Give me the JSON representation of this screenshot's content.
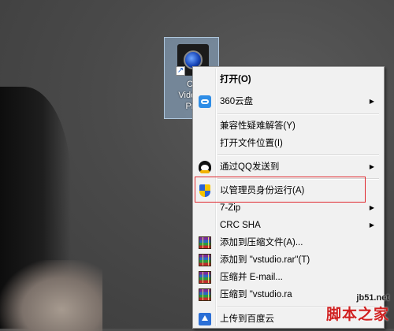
{
  "desktop": {
    "icon_label_lines": [
      "Co",
      "VideoS",
      "Pro"
    ]
  },
  "context_menu": {
    "items": [
      {
        "label": "打开(O)",
        "icon": "none",
        "submenu": false
      },
      {
        "label": "360云盘",
        "icon": "cloud-icon",
        "submenu": true
      },
      {
        "label": "兼容性疑难解答(Y)",
        "icon": "none",
        "submenu": false
      },
      {
        "label": "打开文件位置(I)",
        "icon": "none",
        "submenu": false
      },
      {
        "label": "通过QQ发送到",
        "icon": "qq-icon",
        "submenu": true
      },
      {
        "label": "以管理员身份运行(A)",
        "icon": "shield-icon",
        "submenu": false
      },
      {
        "label": "7-Zip",
        "icon": "none",
        "submenu": true
      },
      {
        "label": "CRC SHA",
        "icon": "none",
        "submenu": true
      },
      {
        "label": "添加到压缩文件(A)...",
        "icon": "winrar-icon",
        "submenu": false
      },
      {
        "label": "添加到 \"vstudio.rar\"(T)",
        "icon": "winrar-icon",
        "submenu": false
      },
      {
        "label": "压缩并 E-mail...",
        "icon": "winrar-icon",
        "submenu": false
      },
      {
        "label": "压缩到 \"vstudio.ra",
        "icon": "winrar-icon",
        "submenu": false
      },
      {
        "label": "上传到百度云",
        "icon": "baidu-cloud-icon",
        "submenu": false
      }
    ],
    "highlighted": "以管理员身份运行(A)",
    "highlight_color": "#e0282e"
  },
  "watermark": {
    "url": "jb51.net",
    "text": "脚本之家"
  },
  "colors": {
    "menu_bg": "#f1f1f1",
    "selection_blue": "#a0c8f0"
  }
}
